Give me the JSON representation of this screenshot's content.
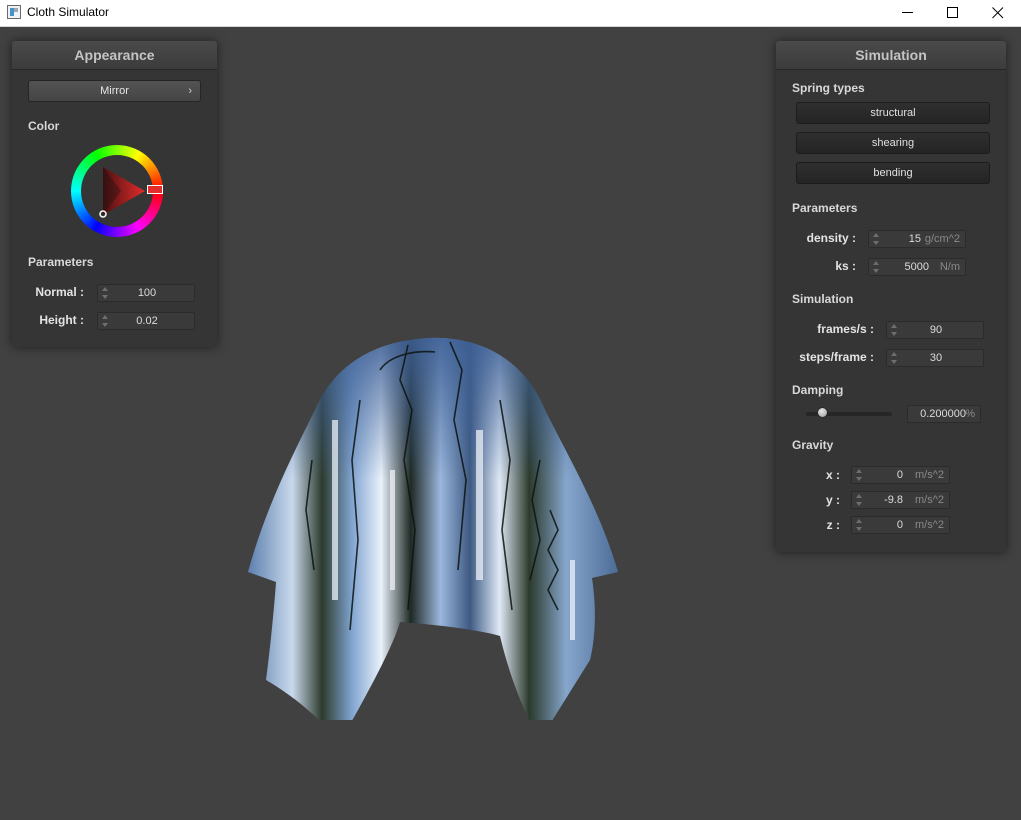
{
  "window": {
    "title": "Cloth Simulator"
  },
  "appearance": {
    "title": "Appearance",
    "shader_label": "Mirror",
    "color_section": "Color",
    "color_hue": "#e32c2c",
    "params_section": "Parameters",
    "normal_label": "Normal :",
    "normal_value": "100",
    "height_label": "Height :",
    "height_value": "0.02"
  },
  "simulation": {
    "title": "Simulation",
    "spring_section": "Spring types",
    "spring_buttons": [
      "structural",
      "shearing",
      "bending"
    ],
    "params_section": "Parameters",
    "density_label": "density :",
    "density_value": "15",
    "density_unit": "g/cm^2",
    "ks_label": "ks :",
    "ks_value": "5000",
    "ks_unit": "N/m",
    "sim_section": "Simulation",
    "fps_label": "frames/s :",
    "fps_value": "90",
    "steps_label": "steps/frame :",
    "steps_value": "30",
    "damping_section": "Damping",
    "damping_value": "0.200000",
    "damping_unit": "%",
    "damping_fraction": 0.2,
    "gravity_section": "Gravity",
    "gx_label": "x :",
    "gx_value": "0",
    "gy_label": "y :",
    "gy_value": "-9.8",
    "gz_label": "z :",
    "gz_value": "0",
    "gravity_unit": "m/s^2"
  }
}
